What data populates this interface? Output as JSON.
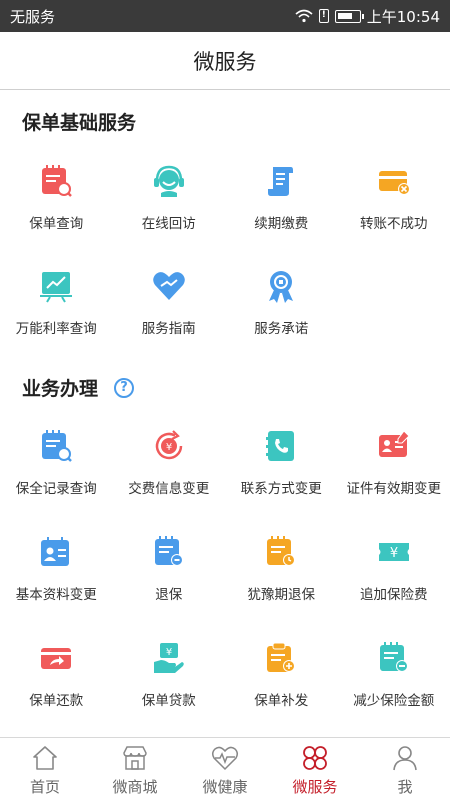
{
  "status_bar": {
    "carrier": "无服务",
    "time": "上午10:54"
  },
  "header": {
    "title": "微服务"
  },
  "section1": {
    "title": "保单基础服务",
    "items": [
      {
        "label": "保单查询",
        "icon": "policy-query-icon"
      },
      {
        "label": "在线回访",
        "icon": "headset-icon"
      },
      {
        "label": "续期缴费",
        "icon": "scroll-icon"
      },
      {
        "label": "转账不成功",
        "icon": "card-failed-icon"
      },
      {
        "label": "万能利率查询",
        "icon": "chart-board-icon"
      },
      {
        "label": "服务指南",
        "icon": "heart-hands-icon"
      },
      {
        "label": "服务承诺",
        "icon": "ribbon-badge-icon"
      }
    ]
  },
  "section2": {
    "title": "业务办理",
    "help": "?",
    "items": [
      {
        "label": "保全记录查询",
        "icon": "record-query-icon"
      },
      {
        "label": "交费信息变更",
        "icon": "yuan-refresh-icon"
      },
      {
        "label": "联系方式变更",
        "icon": "phone-book-icon"
      },
      {
        "label": "证件有效期变更",
        "icon": "id-card-icon"
      },
      {
        "label": "基本资料变更",
        "icon": "profile-card-icon"
      },
      {
        "label": "退保",
        "icon": "surrender-icon"
      },
      {
        "label": "犹豫期退保",
        "icon": "cooling-off-icon"
      },
      {
        "label": "追加保险费",
        "icon": "ticket-yuan-icon"
      },
      {
        "label": "保单还款",
        "icon": "card-repay-icon"
      },
      {
        "label": "保单贷款",
        "icon": "loan-icon"
      },
      {
        "label": "保单补发",
        "icon": "reissue-icon"
      },
      {
        "label": "减少保险金额",
        "icon": "reduce-amount-icon"
      }
    ]
  },
  "bottom_nav": [
    {
      "label": "首页",
      "icon": "home-icon"
    },
    {
      "label": "微商城",
      "icon": "shop-icon"
    },
    {
      "label": "微健康",
      "icon": "health-heart-icon"
    },
    {
      "label": "微服务",
      "icon": "service-clover-icon",
      "active": true
    },
    {
      "label": "我",
      "icon": "person-icon"
    }
  ],
  "colors": {
    "accent": "#c41f2a",
    "red": "#f05a5a",
    "blue": "#4a9bea",
    "teal": "#3cc5c0",
    "orange": "#f5a623"
  }
}
